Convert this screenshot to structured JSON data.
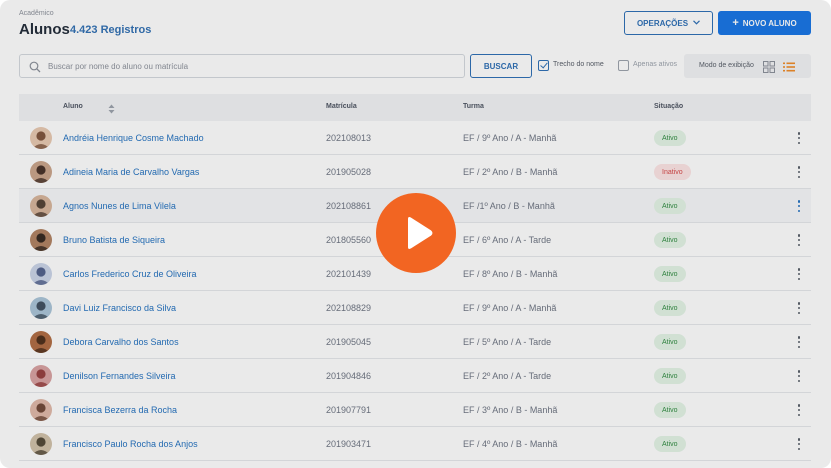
{
  "header": {
    "breadcrumb": "Acadêmico",
    "title": "Alunos",
    "count": "4.423 Registros",
    "operations_label": "OPERAÇÕES",
    "new_student_label": "NOVO ALUNO"
  },
  "search": {
    "placeholder": "Buscar por nome do aluno ou matrícula",
    "value": "",
    "button_label": "BUSCAR",
    "name_excerpt_label": "Trecho do nome",
    "name_excerpt_checked": true,
    "active_only_label": "Apenas ativos",
    "active_only_checked": false
  },
  "view_mode": {
    "label": "Modo de exibição",
    "selected": "list",
    "accent_color": "#f08a24"
  },
  "table": {
    "columns": {
      "student": "Aluno",
      "registration": "Matrícula",
      "class": "Turma",
      "status": "Situação"
    },
    "rows": [
      {
        "name": "Andréia Henrique Cosme Machado",
        "registration": "202108013",
        "class": "EF / 9º Ano / A - Manhã",
        "status": "Ativo"
      },
      {
        "name": "Adineia Maria de Carvalho Vargas",
        "registration": "201905028",
        "class": "EF / 2º Ano / B - Manhã",
        "status": "Inativo"
      },
      {
        "name": "Agnos Nunes de Lima Vilela",
        "registration": "202108861",
        "class": "EF /1º Ano / B - Manhã",
        "status": "Ativo"
      },
      {
        "name": "Bruno Batista de Siqueira",
        "registration": "201805560",
        "class": "EF / 6º Ano / A - Tarde",
        "status": "Ativo"
      },
      {
        "name": "Carlos Frederico Cruz de Oliveira",
        "registration": "202101439",
        "class": "EF / 8º Ano / B - Manhã",
        "status": "Ativo"
      },
      {
        "name": "Davi Luiz Francisco da Silva",
        "registration": "202108829",
        "class": "EF / 9º Ano / A - Manhã",
        "status": "Ativo"
      },
      {
        "name": "Debora Carvalho dos Santos",
        "registration": "201905045",
        "class": "EF / 5º Ano / A - Tarde",
        "status": "Ativo"
      },
      {
        "name": "Denilson Fernandes Silveira",
        "registration": "201904846",
        "class": "EF / 2º Ano / A - Tarde",
        "status": "Ativo"
      },
      {
        "name": "Francisca Bezerra da Rocha",
        "registration": "201907791",
        "class": "EF / 3º Ano / B - Manhã",
        "status": "Ativo"
      },
      {
        "name": "Francisco Paulo Rocha dos Anjos",
        "registration": "201903471",
        "class": "EF / 4º Ano / B - Manhã",
        "status": "Ativo"
      }
    ]
  },
  "colors": {
    "primary": "#1473e6",
    "link": "#1f6fbf",
    "active_bg": "#e3f4e6",
    "inactive_bg": "#fde4e4",
    "play": "#f26522"
  },
  "icons": {
    "search": "search-icon",
    "sort": "sort-icon",
    "grid": "grid-view-icon",
    "list": "list-view-icon",
    "kebab": "kebab-menu-icon",
    "play": "play-icon"
  }
}
